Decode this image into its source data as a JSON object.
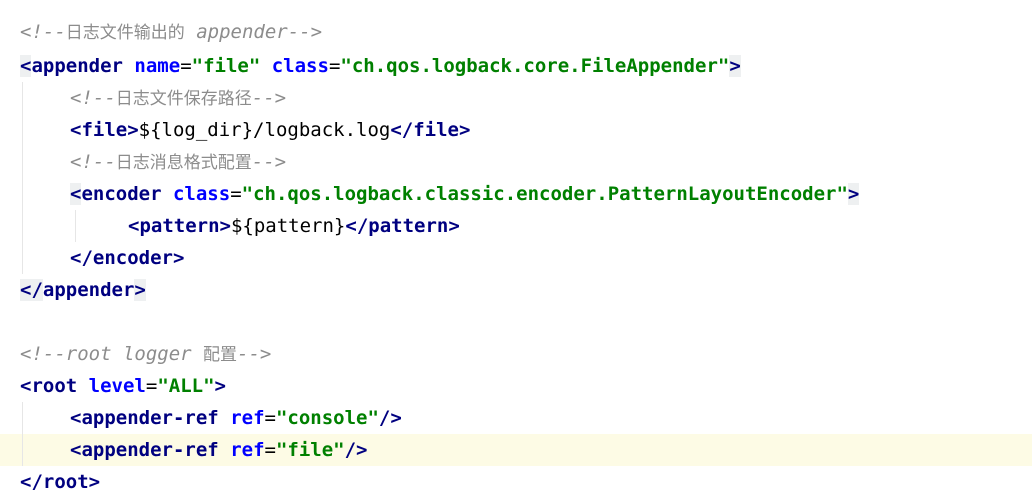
{
  "colors": {
    "background": "#ffffff",
    "current_line": "#fdfbe5",
    "comment": "#8c8c8c",
    "tag": "#000080",
    "attribute": "#0000ff",
    "attribute_value": "#008000",
    "text": "#000000"
  },
  "code": {
    "l1": {
      "comment_open": "<!--",
      "comment_cn": "日志文件输出的",
      "comment_en": " appender",
      "comment_close": "-->"
    },
    "l2": {
      "bracket_open": "<",
      "tag": "appender",
      "attr1": "name",
      "eq1": "=",
      "val1": "\"file\"",
      "attr2": "class",
      "eq2": "=",
      "val2": "\"ch.qos.logback.core.FileAppender\"",
      "bracket_close": ">"
    },
    "l3": {
      "comment_open": "<!--",
      "comment_cn": "日志文件保存路径",
      "comment_close": "-->"
    },
    "l4": {
      "open_lt": "<",
      "open_tag": "file",
      "open_gt": ">",
      "content": "${log_dir}/logback.log",
      "close_lt": "</",
      "close_tag": "file",
      "close_gt": ">"
    },
    "l5": {
      "comment_open": "<!--",
      "comment_cn": "日志消息格式配置",
      "comment_close": "-->"
    },
    "l6": {
      "bracket_open": "<",
      "tag": "encoder",
      "attr1": "class",
      "eq1": "=",
      "val1": "\"ch.qos.logback.classic.encoder.PatternLayoutEncoder\"",
      "bracket_close": ">"
    },
    "l7": {
      "open_lt": "<",
      "open_tag": "pattern",
      "open_gt": ">",
      "content": "${pattern}",
      "close_lt": "</",
      "close_tag": "pattern",
      "close_gt": ">"
    },
    "l8": {
      "close_lt": "</",
      "close_tag": "encoder",
      "close_gt": ">"
    },
    "l9": {
      "close_lt": "</",
      "close_tag": "appender",
      "close_gt": ">"
    },
    "l11": {
      "comment_open": "<!--",
      "comment_en": "root logger ",
      "comment_cn": "配置",
      "comment_close": "-->"
    },
    "l12": {
      "bracket_open": "<",
      "tag": "root",
      "attr1": "level",
      "eq1": "=",
      "val1": "\"ALL\"",
      "bracket_close": ">"
    },
    "l13": {
      "bracket_open": "<",
      "tag": "appender-ref",
      "attr1": "ref",
      "eq1": "=",
      "val1": "\"console\"",
      "bracket_close": "/>"
    },
    "l14": {
      "bracket_open": "<",
      "tag": "appender-ref",
      "attr1": "ref",
      "eq1": "=",
      "val1": "\"file\"",
      "bracket_close": "/>"
    },
    "l15": {
      "close_lt": "</",
      "close_tag": "root",
      "close_gt": ">"
    }
  }
}
